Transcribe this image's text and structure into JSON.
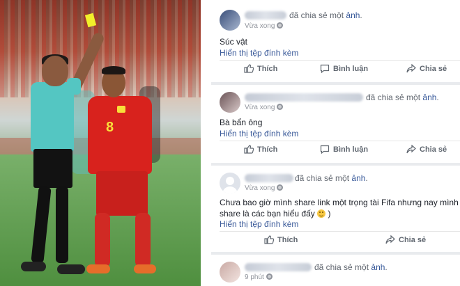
{
  "posts": [
    {
      "action_verb": "đã chia sẻ một",
      "action_link": "ảnh",
      "time": "Vừa xong",
      "text": "Súc vật",
      "attachment_link": "Hiển thị tệp đính kèm",
      "buttons": {
        "like": "Thích",
        "comment": "Bình luận",
        "share": "Chia sẻ"
      }
    },
    {
      "action_verb": "đã chia sẻ một",
      "action_link": "ảnh",
      "time": "Vừa xong",
      "text": "Bà bẩn ông",
      "attachment_link": "Hiển thị tệp đính kèm",
      "buttons": {
        "like": "Thích",
        "comment": "Bình luận",
        "share": "Chia sẻ"
      }
    },
    {
      "action_verb": "đã chia sẻ một",
      "action_link": "ảnh",
      "time": "Vừa xong",
      "text": "Chưa bao giờ mình share link một trọng tài Fifa nhưng nay mình share là các bạn hiểu đấy",
      "attachment_link": "Hiển thị tệp đính kèm",
      "buttons": {
        "like": "Thích",
        "share": "Chia sẻ"
      }
    },
    {
      "action_verb": "đã chia sẻ một",
      "action_link": "ảnh",
      "time": "9 phút"
    }
  ],
  "photo": {
    "jersey_number": "8"
  },
  "colors": {
    "link": "#385898",
    "meta": "#90949c",
    "button": "#606770",
    "divider": "#e9ebee"
  }
}
